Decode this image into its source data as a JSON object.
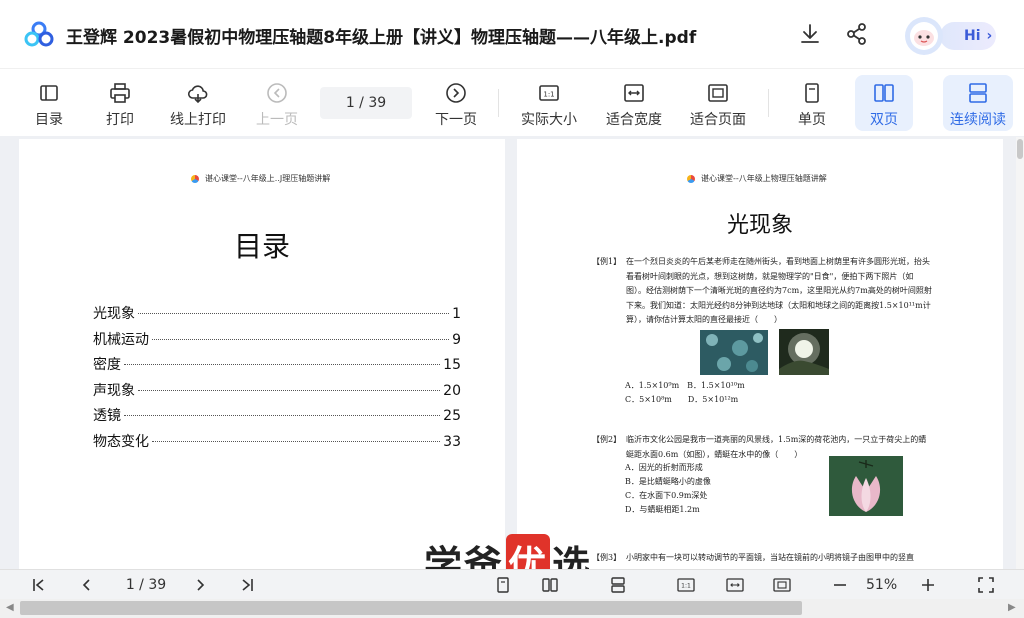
{
  "titlebar": {
    "title": "王登辉 2023暑假初中物理压轴题8年级上册【讲义】物理压轴题——八年级上.pdf",
    "download_icon": "download-icon",
    "share_icon": "share-icon",
    "assistant_label": "Hi"
  },
  "toolbar": {
    "items": [
      {
        "label": "目录",
        "icon": "toc-icon"
      },
      {
        "label": "打印",
        "icon": "printer-icon"
      },
      {
        "label": "线上打印",
        "icon": "cloud-print-icon"
      },
      {
        "label": "上一页",
        "icon": "prev-page-icon"
      },
      {
        "label": "下一页",
        "icon": "next-page-icon"
      },
      {
        "label": "实际大小",
        "icon": "actual-size-icon"
      },
      {
        "label": "适合宽度",
        "icon": "fit-width-icon"
      },
      {
        "label": "适合页面",
        "icon": "fit-page-icon"
      },
      {
        "label": "单页",
        "icon": "single-page-icon"
      },
      {
        "label": "双页",
        "icon": "double-page-icon"
      },
      {
        "label": "连续阅读",
        "icon": "continuous-icon"
      }
    ],
    "page_indicator": "1 / 39"
  },
  "left_page": {
    "header": "谌心课堂--八年级上..J理压轴题讲解",
    "title": "目录",
    "toc": [
      {
        "title": "光现象",
        "page": "1"
      },
      {
        "title": "机械运动",
        "page": "9"
      },
      {
        "title": "密度",
        "page": "15"
      },
      {
        "title": "声现象",
        "page": "20"
      },
      {
        "title": "透镜",
        "page": "25"
      },
      {
        "title": "物态变化",
        "page": "33"
      }
    ]
  },
  "right_page": {
    "header": "谌心课堂--八年级上物理压轴题讲解",
    "title": "光现象",
    "q1_tag": "【例1】",
    "q1_text": "在一个烈日炎炎的午后某老师走在随州街头，看到地面上树荫里有许多圆形光斑，抬头看看树叶间刺眼的光点，想到这树荫，就是物理学的\"日食\"，便拍下两下照片（如图）。经估测树荫下一个清晰光斑的直径约为7cm，这里阳光从约7m高处的树叶间照射下来。我们知道：太阳光经约8分钟到达地球（太阳和地球之间的距离按1.5×10¹¹m计算），请你估计算太阳的直径最接近（　　）",
    "q1_options": [
      "A．1.5×10⁹m　B．1.5×10¹⁰m",
      "C．5×10⁸m　　D．5×10¹²m"
    ],
    "q2_tag": "【例2】",
    "q2_text": "临沂市文化公园是我市一道亮丽的风景线，1.5m深的荷花池内，一只立于荷尖上的蜻蜓距水面0.6m（如图），蜻蜓在水中的像（　　）",
    "q2_options": [
      "A．因光的折射而形成",
      "B．是比蜻蜓略小的虚像",
      "C．在水面下0.9m深处",
      "D．与蜻蜓相距1.2m"
    ],
    "q3_tag": "【例3】",
    "q3_text": "小明家中有一块可以转动调节的平面镜，当站在镜前的小明将镜子由图甲中的竖直"
  },
  "watermark": {
    "a": "学爸",
    "b": "优",
    "c": "选"
  },
  "bottombar": {
    "page_indicator": "1 / 39",
    "zoom": "51%"
  },
  "colors": {
    "accent": "#2f6be6",
    "active_bg": "#e8f0fd",
    "watermark_red": "#e0332a"
  }
}
